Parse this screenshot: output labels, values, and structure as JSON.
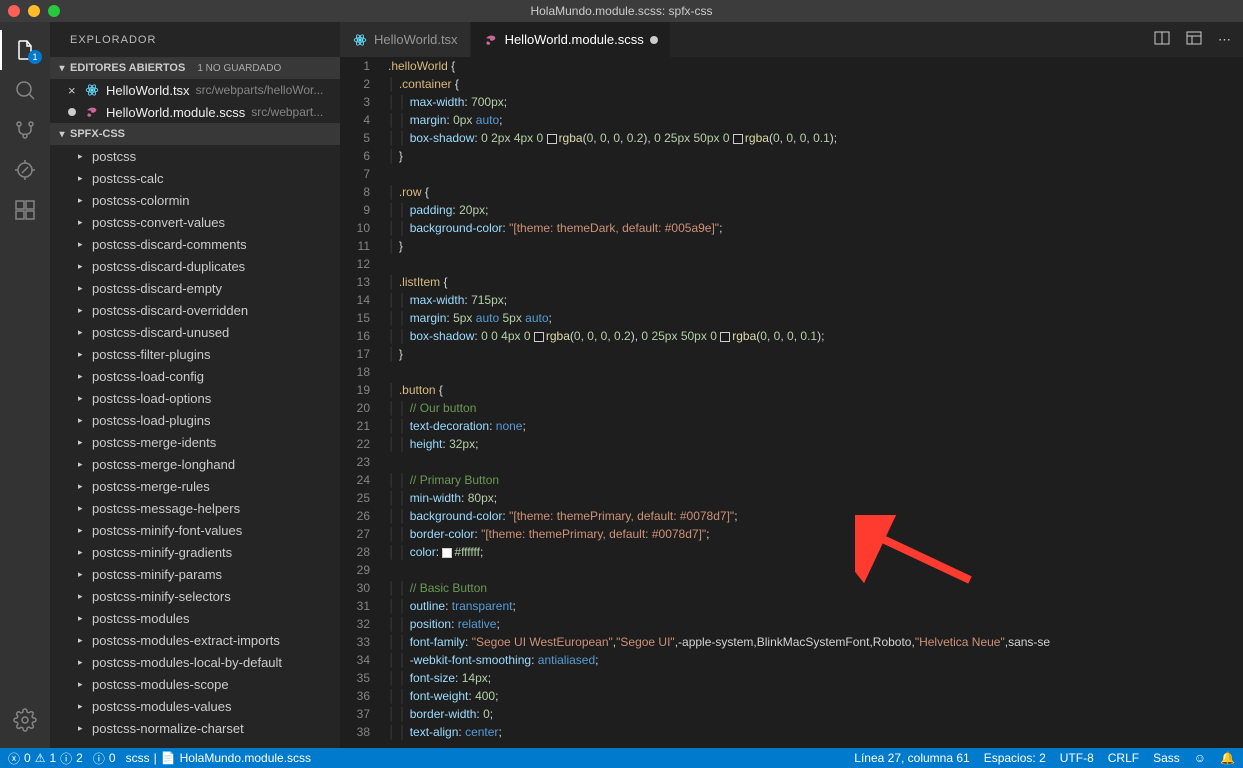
{
  "titlebar": {
    "title": "HolaMundo.module.scss: spfx-css"
  },
  "activity": {
    "explorer_badge": "1"
  },
  "explorer": {
    "title": "EXPLORADOR",
    "openEditors": {
      "header": "EDITORES ABIERTOS",
      "badge": "1 NO GUARDADO",
      "items": [
        {
          "name": "HelloWorld.tsx",
          "path": "src/webparts/helloWor...",
          "dirty": false,
          "icon": "react"
        },
        {
          "name": "HelloWorld.module.scss",
          "path": "src/webpart...",
          "dirty": true,
          "icon": "scss"
        }
      ]
    },
    "workspace": {
      "header": "SPFX-CSS",
      "folders": [
        "postcss",
        "postcss-calc",
        "postcss-colormin",
        "postcss-convert-values",
        "postcss-discard-comments",
        "postcss-discard-duplicates",
        "postcss-discard-empty",
        "postcss-discard-overridden",
        "postcss-discard-unused",
        "postcss-filter-plugins",
        "postcss-load-config",
        "postcss-load-options",
        "postcss-load-plugins",
        "postcss-merge-idents",
        "postcss-merge-longhand",
        "postcss-merge-rules",
        "postcss-message-helpers",
        "postcss-minify-font-values",
        "postcss-minify-gradients",
        "postcss-minify-params",
        "postcss-minify-selectors",
        "postcss-modules",
        "postcss-modules-extract-imports",
        "postcss-modules-local-by-default",
        "postcss-modules-scope",
        "postcss-modules-values",
        "postcss-normalize-charset"
      ]
    }
  },
  "tabs": [
    {
      "name": "HelloWorld.tsx",
      "active": false,
      "dirty": false,
      "icon": "react"
    },
    {
      "name": "HelloWorld.module.scss",
      "active": true,
      "dirty": true,
      "icon": "scss"
    }
  ],
  "code": {
    "lines": [
      {
        "n": 1,
        "html": "<span class='tok-sel'>.helloWorld</span> <span class='tok-punc'>{</span>"
      },
      {
        "n": 2,
        "html": "  <span class='tok-sel'>.container</span> <span class='tok-punc'>{</span>"
      },
      {
        "n": 3,
        "html": "    <span class='tok-prop'>max-width</span><span class='tok-punc'>:</span> <span class='tok-num'>700px</span><span class='tok-punc'>;</span>"
      },
      {
        "n": 4,
        "html": "    <span class='tok-prop'>margin</span><span class='tok-punc'>:</span> <span class='tok-num'>0px</span> <span class='tok-kw'>auto</span><span class='tok-punc'>;</span>"
      },
      {
        "n": 5,
        "html": "    <span class='tok-prop'>box-shadow</span><span class='tok-punc'>:</span> <span class='tok-num'>0</span> <span class='tok-num'>2px</span> <span class='tok-num'>4px</span> <span class='tok-num'>0</span> <span class='color-box' style='background:rgba(0,0,0,0.2)'></span><span class='tok-fn'>rgba</span><span class='tok-punc'>(</span><span class='tok-num'>0</span><span class='tok-punc'>,</span> <span class='tok-num'>0</span><span class='tok-punc'>,</span> <span class='tok-num'>0</span><span class='tok-punc'>,</span> <span class='tok-num'>0.2</span><span class='tok-punc'>),</span> <span class='tok-num'>0</span> <span class='tok-num'>25px</span> <span class='tok-num'>50px</span> <span class='tok-num'>0</span> <span class='color-box' style='background:rgba(0,0,0,0.1)'></span><span class='tok-fn'>rgba</span><span class='tok-punc'>(</span><span class='tok-num'>0</span><span class='tok-punc'>,</span> <span class='tok-num'>0</span><span class='tok-punc'>,</span> <span class='tok-num'>0</span><span class='tok-punc'>,</span> <span class='tok-num'>0.1</span><span class='tok-punc'>);</span>"
      },
      {
        "n": 6,
        "html": "  <span class='tok-punc'>}</span>"
      },
      {
        "n": 7,
        "html": ""
      },
      {
        "n": 8,
        "html": "  <span class='tok-sel'>.row</span> <span class='tok-punc'>{</span>"
      },
      {
        "n": 9,
        "html": "    <span class='tok-prop'>padding</span><span class='tok-punc'>:</span> <span class='tok-num'>20px</span><span class='tok-punc'>;</span>"
      },
      {
        "n": 10,
        "html": "    <span class='tok-prop'>background-color</span><span class='tok-punc'>:</span> <span class='tok-str'>\"[theme: themeDark, default: #005a9e]\"</span><span class='tok-punc'>;</span>"
      },
      {
        "n": 11,
        "html": "  <span class='tok-punc'>}</span>"
      },
      {
        "n": 12,
        "html": ""
      },
      {
        "n": 13,
        "html": "  <span class='tok-sel'>.listItem</span> <span class='tok-punc'>{</span>"
      },
      {
        "n": 14,
        "html": "    <span class='tok-prop'>max-width</span><span class='tok-punc'>:</span> <span class='tok-num'>715px</span><span class='tok-punc'>;</span>"
      },
      {
        "n": 15,
        "html": "    <span class='tok-prop'>margin</span><span class='tok-punc'>:</span> <span class='tok-num'>5px</span> <span class='tok-kw'>auto</span> <span class='tok-num'>5px</span> <span class='tok-kw'>auto</span><span class='tok-punc'>;</span>"
      },
      {
        "n": 16,
        "html": "    <span class='tok-prop'>box-shadow</span><span class='tok-punc'>:</span> <span class='tok-num'>0</span> <span class='tok-num'>0</span> <span class='tok-num'>4px</span> <span class='tok-num'>0</span> <span class='color-box' style='background:rgba(0,0,0,0.2)'></span><span class='tok-fn'>rgba</span><span class='tok-punc'>(</span><span class='tok-num'>0</span><span class='tok-punc'>,</span> <span class='tok-num'>0</span><span class='tok-punc'>,</span> <span class='tok-num'>0</span><span class='tok-punc'>,</span> <span class='tok-num'>0.2</span><span class='tok-punc'>),</span> <span class='tok-num'>0</span> <span class='tok-num'>25px</span> <span class='tok-num'>50px</span> <span class='tok-num'>0</span> <span class='color-box' style='background:rgba(0,0,0,0.1)'></span><span class='tok-fn'>rgba</span><span class='tok-punc'>(</span><span class='tok-num'>0</span><span class='tok-punc'>,</span> <span class='tok-num'>0</span><span class='tok-punc'>,</span> <span class='tok-num'>0</span><span class='tok-punc'>,</span> <span class='tok-num'>0.1</span><span class='tok-punc'>);</span>"
      },
      {
        "n": 17,
        "html": "  <span class='tok-punc'>}</span>"
      },
      {
        "n": 18,
        "html": ""
      },
      {
        "n": 19,
        "html": "  <span class='tok-sel'>.button</span> <span class='tok-punc'>{</span>"
      },
      {
        "n": 20,
        "html": "    <span class='tok-comment'>// Our button</span>"
      },
      {
        "n": 21,
        "html": "    <span class='tok-prop'>text-decoration</span><span class='tok-punc'>:</span> <span class='tok-kw'>none</span><span class='tok-punc'>;</span>"
      },
      {
        "n": 22,
        "html": "    <span class='tok-prop'>height</span><span class='tok-punc'>:</span> <span class='tok-num'>32px</span><span class='tok-punc'>;</span>"
      },
      {
        "n": 23,
        "html": ""
      },
      {
        "n": 24,
        "html": "    <span class='tok-comment'>// Primary Button</span>"
      },
      {
        "n": 25,
        "html": "    <span class='tok-prop'>min-width</span><span class='tok-punc'>:</span> <span class='tok-num'>80px</span><span class='tok-punc'>;</span>"
      },
      {
        "n": 26,
        "html": "    <span class='tok-prop'>background-color</span><span class='tok-punc'>:</span> <span class='tok-str'>\"[theme: themePrimary, default: #0078d7]\"</span><span class='tok-punc'>;</span>"
      },
      {
        "n": 27,
        "html": "    <span class='tok-prop'>border-color</span><span class='tok-punc'>:</span> <span class='tok-str'>\"[theme: themePrimary, default: #0078d7]\"</span><span class='tok-punc'>;</span>"
      },
      {
        "n": 28,
        "html": "    <span class='tok-prop'>color</span><span class='tok-punc'>:</span> <span class='color-box' style='background:#ffffff'></span><span class='tok-num'>#ffffff</span><span class='tok-punc'>;</span>"
      },
      {
        "n": 29,
        "html": ""
      },
      {
        "n": 30,
        "html": "    <span class='tok-comment'>// Basic Button</span>"
      },
      {
        "n": 31,
        "html": "    <span class='tok-prop'>outline</span><span class='tok-punc'>:</span> <span class='tok-kw'>transparent</span><span class='tok-punc'>;</span>"
      },
      {
        "n": 32,
        "html": "    <span class='tok-prop'>position</span><span class='tok-punc'>:</span> <span class='tok-kw'>relative</span><span class='tok-punc'>;</span>"
      },
      {
        "n": 33,
        "html": "    <span class='tok-prop'>font-family</span><span class='tok-punc'>:</span> <span class='tok-str'>\"Segoe UI WestEuropean\"</span><span class='tok-punc'>,</span><span class='tok-str'>\"Segoe UI\"</span><span class='tok-punc'>,</span>-apple-system<span class='tok-punc'>,</span>BlinkMacSystemFont<span class='tok-punc'>,</span>Roboto<span class='tok-punc'>,</span><span class='tok-str'>\"Helvetica Neue\"</span><span class='tok-punc'>,</span>sans-se"
      },
      {
        "n": 34,
        "html": "    <span class='tok-prop'>-webkit-font-smoothing</span><span class='tok-punc'>:</span> <span class='tok-kw'>antialiased</span><span class='tok-punc'>;</span>"
      },
      {
        "n": 35,
        "html": "    <span class='tok-prop'>font-size</span><span class='tok-punc'>:</span> <span class='tok-num'>14px</span><span class='tok-punc'>;</span>"
      },
      {
        "n": 36,
        "html": "    <span class='tok-prop'>font-weight</span><span class='tok-punc'>:</span> <span class='tok-num'>400</span><span class='tok-punc'>;</span>"
      },
      {
        "n": 37,
        "html": "    <span class='tok-prop'>border-width</span><span class='tok-punc'>:</span> <span class='tok-num'>0</span><span class='tok-punc'>;</span>"
      },
      {
        "n": 38,
        "html": "    <span class='tok-prop'>text-align</span><span class='tok-punc'>:</span> <span class='tok-kw'>center</span><span class='tok-punc'>;</span>"
      }
    ]
  },
  "status": {
    "errors": "0",
    "warnings": "1",
    "infos": "2",
    "port": "0",
    "lang": "scss",
    "file": "HolaMundo.module.scss",
    "cursor": "Línea 27, columna 61",
    "spaces": "Espacios: 2",
    "encoding": "UTF-8",
    "eol": "CRLF",
    "mode": "Sass"
  }
}
